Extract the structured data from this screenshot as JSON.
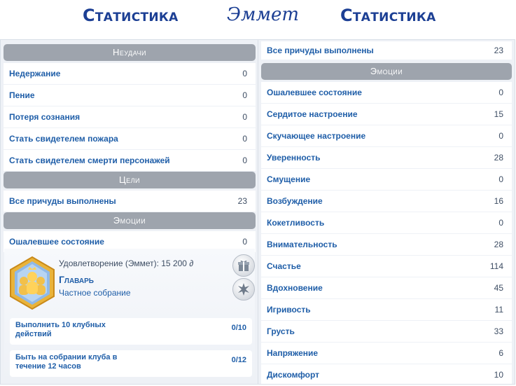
{
  "titles": {
    "left": "Статистика",
    "center": "Эммет",
    "right": "Статистика"
  },
  "left_panel": {
    "failures_header": "Неудачи",
    "failures": [
      {
        "label": "Недержание",
        "value": "0"
      },
      {
        "label": "Пение",
        "value": "0"
      },
      {
        "label": "Потеря сознания",
        "value": "0"
      },
      {
        "label": "Стать свидетелем пожара",
        "value": "0"
      },
      {
        "label": "Стать свидетелем смерти персонажей",
        "value": "0"
      }
    ],
    "goals_header": "Цели",
    "goals": [
      {
        "label": "Все причуды выполнены",
        "value": "23"
      }
    ],
    "emotions_header": "Эмоции",
    "emotions": [
      {
        "label": "Ошалевшее состояние",
        "value": "0"
      }
    ]
  },
  "club_card": {
    "satisfaction_label": "Удовлетворение (Эммет): 15",
    "satisfaction_points": "200",
    "role": "Главарь",
    "subtitle": "Частное собрание",
    "tasks": [
      {
        "label": "Выполнить 10 клубных действий",
        "value": "0/10"
      },
      {
        "label": "Быть на собрании клуба в течение 12 часов",
        "value": "0/12"
      }
    ]
  },
  "right_panel": {
    "top_row": {
      "label": "Все причуды выполнены",
      "value": "23"
    },
    "emotions_header": "Эмоции",
    "emotions": [
      {
        "label": "Ошалевшее состояние",
        "value": "0"
      },
      {
        "label": "Сердитое настроение",
        "value": "15"
      },
      {
        "label": "Скучающее настроение",
        "value": "0"
      },
      {
        "label": "Уверенность",
        "value": "28"
      },
      {
        "label": "Смущение",
        "value": "0"
      },
      {
        "label": "Возбуждение",
        "value": "16"
      },
      {
        "label": "Кокетливость",
        "value": "0"
      },
      {
        "label": "Внимательность",
        "value": "28"
      },
      {
        "label": "Счастье",
        "value": "114"
      },
      {
        "label": "Вдохновение",
        "value": "45"
      },
      {
        "label": "Игривость",
        "value": "11"
      },
      {
        "label": "Грусть",
        "value": "33"
      },
      {
        "label": "Напряжение",
        "value": "6"
      },
      {
        "label": "Дискомфорт",
        "value": "10"
      }
    ]
  },
  "icons": {
    "gift": "gift-icon",
    "spark": "star-burst-icon",
    "badge": "club-leader-badge-icon",
    "satisfaction": "satisfaction-points-icon"
  },
  "colors": {
    "title": "#1c3f94",
    "label": "#1f5ea8",
    "header_bg": "#9ea4ad",
    "panel_bg": "#eef1f6"
  }
}
